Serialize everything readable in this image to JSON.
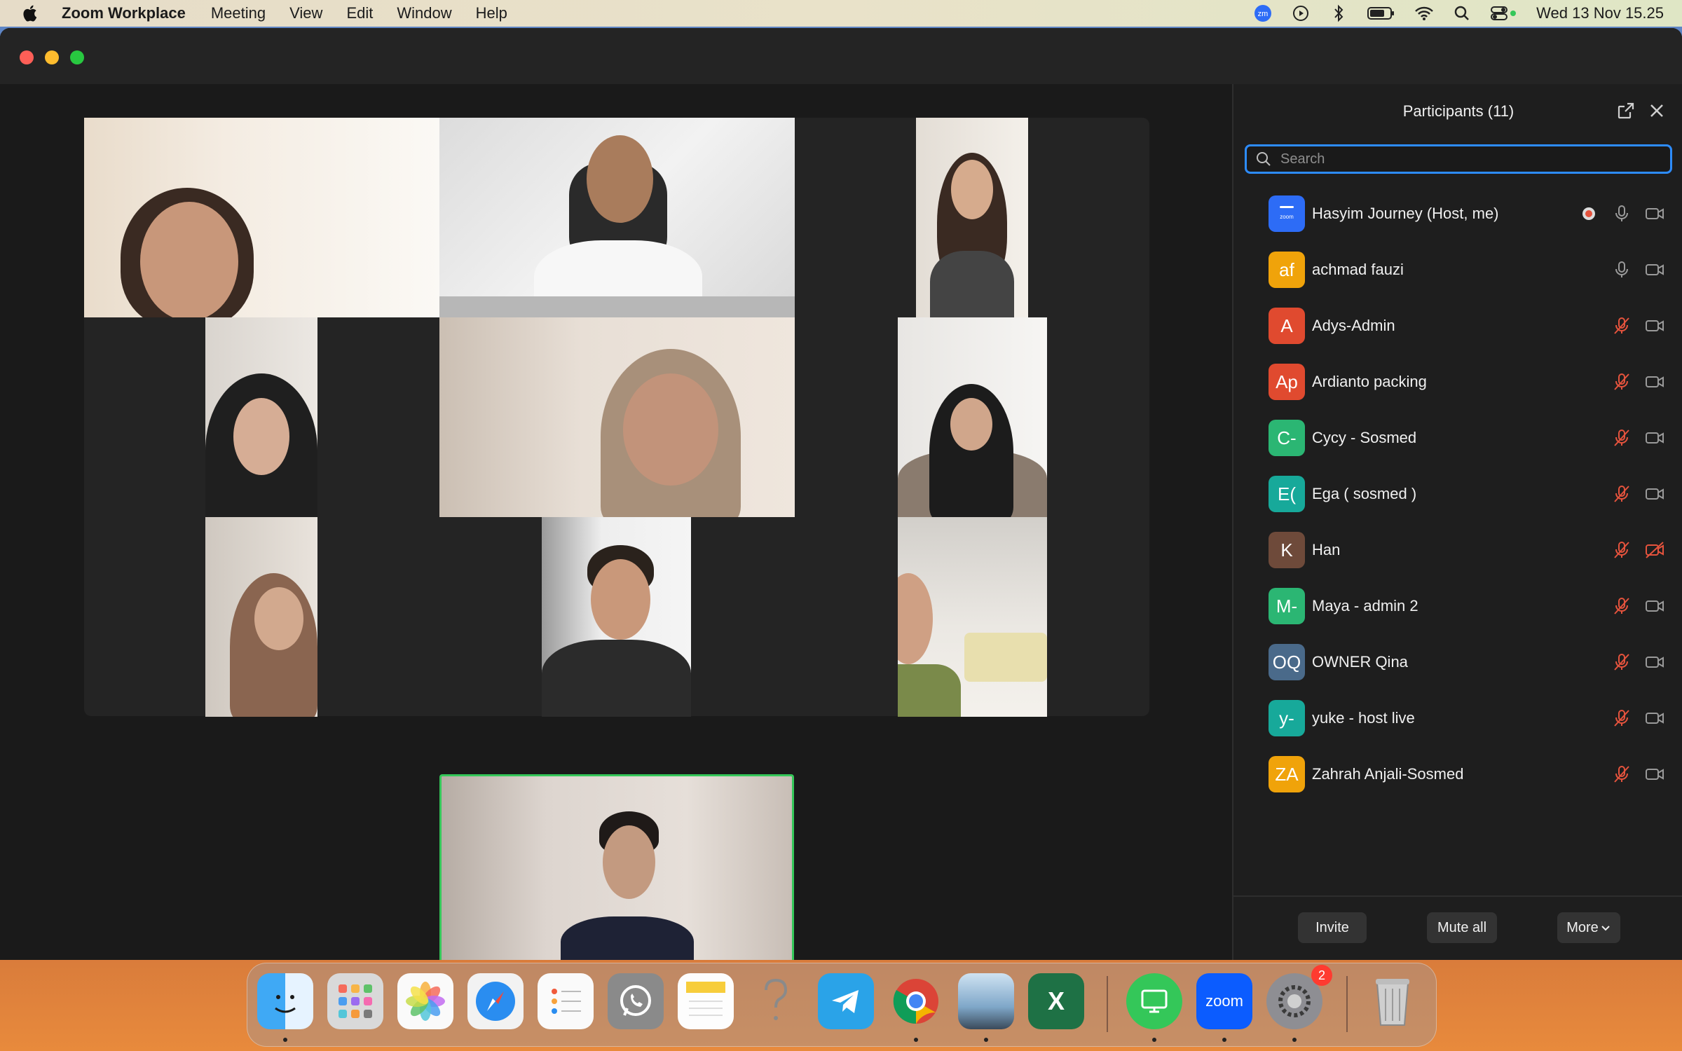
{
  "menubar": {
    "app_name": "Zoom Workplace",
    "items": [
      "Meeting",
      "View",
      "Edit",
      "Window",
      "Help"
    ],
    "clock": "Wed 13 Nov  15.25"
  },
  "panel": {
    "title": "Participants (11)",
    "search_placeholder": "Search",
    "participants": [
      {
        "initials": "",
        "name": "Hasyim Journey (Host, me)",
        "color": "#2d6cf6",
        "mic": "on",
        "cam": "off",
        "recording": true,
        "zoom_avatar": true
      },
      {
        "initials": "af",
        "name": "achmad fauzi",
        "color": "#f0a30a",
        "mic": "on",
        "cam": "off"
      },
      {
        "initials": "A",
        "name": "Adys-Admin",
        "color": "#e04a2f",
        "mic": "muted",
        "cam": "off"
      },
      {
        "initials": "Ap",
        "name": "Ardianto packing",
        "color": "#e04a2f",
        "mic": "muted",
        "cam": "off"
      },
      {
        "initials": "C-",
        "name": "Cycy - Sosmed",
        "color": "#2bb673",
        "mic": "muted",
        "cam": "off"
      },
      {
        "initials": "E(",
        "name": "Ega ( sosmed )",
        "color": "#17a99a",
        "mic": "muted",
        "cam": "off"
      },
      {
        "initials": "K",
        "name": "Han",
        "color": "#6e4a3a",
        "mic": "muted",
        "cam": "muted"
      },
      {
        "initials": "M-",
        "name": "Maya - admin 2",
        "color": "#2bb673",
        "mic": "muted",
        "cam": "off"
      },
      {
        "initials": "OQ",
        "name": "OWNER Qina",
        "color": "#4a6a8a",
        "mic": "muted",
        "cam": "off"
      },
      {
        "initials": "y-",
        "name": "yuke - host live",
        "color": "#17a99a",
        "mic": "muted",
        "cam": "off"
      },
      {
        "initials": "ZA",
        "name": "Zahrah Anjali-Sosmed",
        "color": "#f0a30a",
        "mic": "muted",
        "cam": "off"
      }
    ],
    "footer": {
      "invite": "Invite",
      "mute_all": "Mute all",
      "more": "More"
    }
  },
  "dock": {
    "zoom_label": "zoom",
    "settings_badge": "2",
    "excel_letter": "X"
  }
}
